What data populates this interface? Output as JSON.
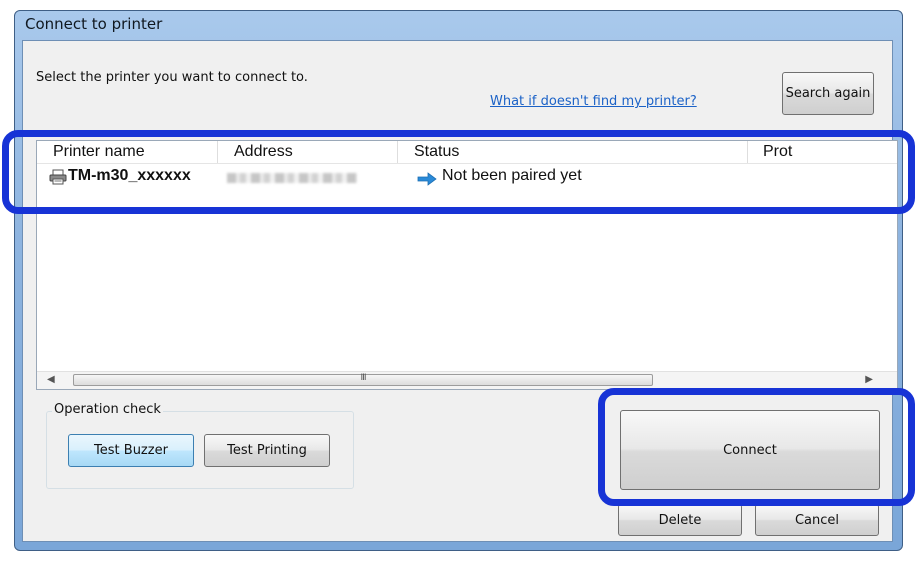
{
  "window": {
    "title": "Connect to printer"
  },
  "instruction": "Select the printer you want to connect to.",
  "help_link": "What if doesn't find my printer?",
  "buttons": {
    "search_again": "Search again",
    "test_buzzer": "Test Buzzer",
    "test_printing": "Test Printing",
    "connect": "Connect",
    "delete": "Delete",
    "cancel": "Cancel"
  },
  "list": {
    "columns": [
      "Printer name",
      "Address",
      "Status",
      "Prot"
    ],
    "rows": [
      {
        "printer_name": "TM-m30_xxxxxx",
        "address": "",
        "status": "Not been paired yet"
      }
    ],
    "scroll_grip": "III"
  },
  "operation_check": {
    "title": "Operation check"
  },
  "icons": {
    "printer": "printer-icon",
    "status": "arrow-right-icon"
  },
  "colors": {
    "highlight": "#1733d6",
    "link": "#1b62c7",
    "status_arrow": "#2a8ad8"
  }
}
